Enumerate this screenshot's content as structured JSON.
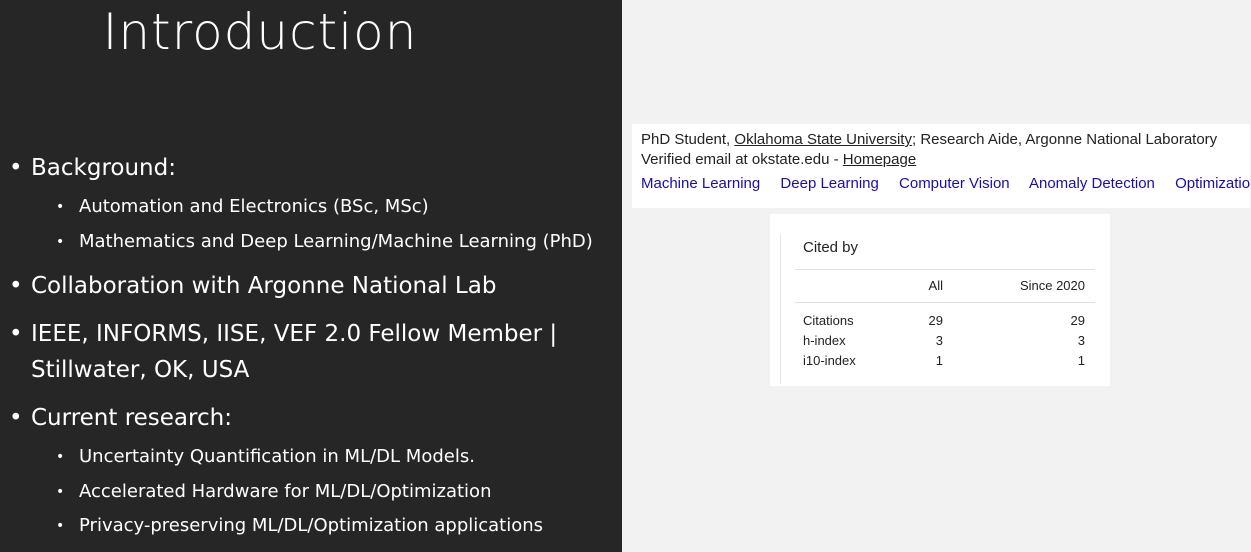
{
  "slide": {
    "title": "Introduction",
    "bullets": [
      {
        "text": "Background:",
        "sub": [
          "Automation and Electronics (BSc, MSc)",
          "Mathematics and Deep Learning/Machine Learning (PhD)"
        ]
      },
      {
        "text": "Collaboration with Argonne National Lab",
        "sub": []
      },
      {
        "text": "IEEE, INFORMS, IISE, VEF 2.0 Fellow Member |",
        "text2": "Stillwater, OK, USA",
        "sub": []
      },
      {
        "text": "Current research:",
        "sub": [
          "Uncertainty Quantification in ML/DL Models.",
          "Accelerated Hardware for ML/DL/Optimization",
          "Privacy-preserving ML/DL/Optimization applications"
        ]
      }
    ],
    "bullet_glyph": "•"
  },
  "profile": {
    "line1_prefix": "PhD Student, ",
    "university": "Oklahoma State University",
    "line1_suffix": "; Research Aide, Argonne National Laboratory",
    "line2_prefix": "Verified email at okstate.edu - ",
    "homepage": "Homepage",
    "interests": [
      "Machine Learning",
      "Deep Learning",
      "Computer Vision",
      "Anomaly Detection",
      "Optimization"
    ]
  },
  "cited": {
    "title": "Cited by",
    "col_all": "All",
    "col_since": "Since 2020",
    "rows": [
      {
        "label": "Citations",
        "all": "29",
        "since": "29"
      },
      {
        "label": "h-index",
        "all": "3",
        "since": "3"
      },
      {
        "label": "i10-index",
        "all": "1",
        "since": "1"
      }
    ]
  },
  "colors": {
    "slide_bg": "#262626",
    "link": "#1a0dab"
  }
}
